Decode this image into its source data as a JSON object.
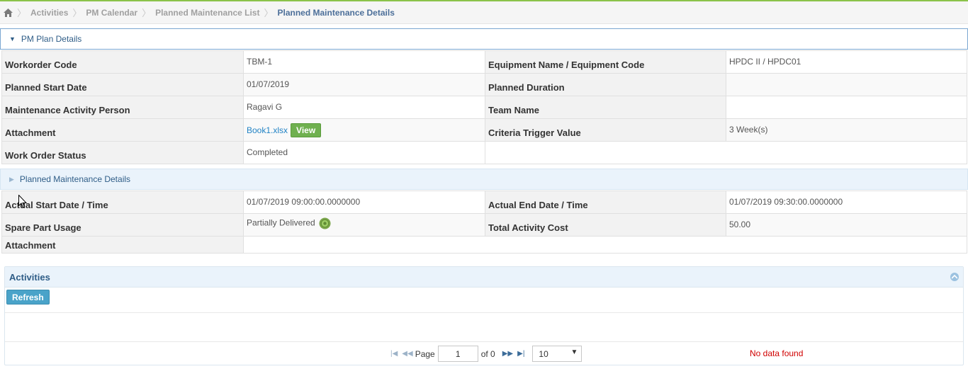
{
  "breadcrumb": {
    "items": [
      "Activities",
      "PM Calendar",
      "Planned Maintenance List"
    ],
    "active": "Planned Maintenance Details",
    "home_icon": "home-icon"
  },
  "pm_plan": {
    "header": "PM Plan Details",
    "rows": [
      {
        "l1": "Workorder Code",
        "v1": "TBM-1",
        "l2": "Equipment Name / Equipment Code",
        "v2": "HPDC II / HPDC01"
      },
      {
        "l1": "Planned Start Date",
        "v1": "01/07/2019",
        "l2": "Planned Duration",
        "v2": ""
      },
      {
        "l1": "Maintenance Activity Person",
        "v1": "Ragavi G",
        "l2": "Team Name",
        "v2": ""
      },
      {
        "l1": "Attachment",
        "v1_link": "Book1.xlsx",
        "v1_button": "View",
        "l2": "Criteria Trigger Value",
        "v2": "3 Week(s)"
      },
      {
        "l1": "Work Order Status",
        "v1": "Completed"
      }
    ]
  },
  "pm_details": {
    "header": "Planned Maintenance Details",
    "rows": [
      {
        "l1": "Actual Start Date / Time",
        "v1": "01/07/2019 09:00:00.0000000",
        "l2": "Actual End Date / Time",
        "v2": "01/07/2019 09:30:00.0000000"
      },
      {
        "l1": "Spare Part Usage",
        "v1": "Partially Delivered",
        "l2": "Total Activity Cost",
        "v2": "50.00"
      },
      {
        "l1": "Attachment",
        "v1": ""
      }
    ]
  },
  "activities": {
    "header": "Activities",
    "refresh_label": "Refresh",
    "pager": {
      "page_label": "Page",
      "page_value": "1",
      "of_label": "of 0",
      "page_size": "10",
      "no_data": "No data found"
    }
  },
  "colors": {
    "accent_green": "#8bc34a",
    "view_button": "#6fb04f",
    "refresh_button": "#4aa3c9",
    "no_data_red": "#d00000",
    "link_blue": "#2283c5"
  }
}
